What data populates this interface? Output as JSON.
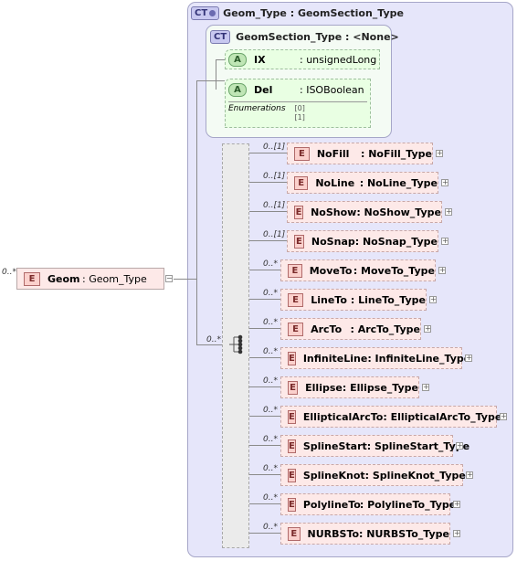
{
  "root_element": {
    "occurs": "0..*",
    "name": "Geom",
    "type": ": Geom_Type"
  },
  "complex_type": {
    "badge": "CT",
    "title": "Geom_Type : GeomSection_Type"
  },
  "base_type": {
    "badge": "CT",
    "title": "GeomSection_Type : <None>",
    "attributes": [
      {
        "badge": "A",
        "name": "IX",
        "type": ": unsignedLong"
      },
      {
        "badge": "A",
        "name": "Del",
        "type": ": ISOBoolean",
        "enum_label": "Enumerations",
        "enum_values": [
          "[0]",
          "[1]"
        ]
      }
    ]
  },
  "sequence": {
    "occurs": "0..*"
  },
  "children": [
    {
      "occurs": "0..[1]",
      "name": "NoFill",
      "type": ": NoFill_Type"
    },
    {
      "occurs": "0..[1]",
      "name": "NoLine",
      "type": ": NoLine_Type"
    },
    {
      "occurs": "0..[1]",
      "name": "NoShow",
      "type": ": NoShow_Type"
    },
    {
      "occurs": "0..[1]",
      "name": "NoSnap",
      "type": ": NoSnap_Type"
    },
    {
      "occurs": "0..*",
      "name": "MoveTo",
      "type": ": MoveTo_Type"
    },
    {
      "occurs": "0..*",
      "name": "LineTo",
      "type": ": LineTo_Type"
    },
    {
      "occurs": "0..*",
      "name": "ArcTo",
      "type": ": ArcTo_Type"
    },
    {
      "occurs": "0..*",
      "name": "InfiniteLine",
      "type": ": InfiniteLine_Type"
    },
    {
      "occurs": "0..*",
      "name": "Ellipse",
      "type": ": Ellipse_Type"
    },
    {
      "occurs": "0..*",
      "name": "EllipticalArcTo",
      "type": ": EllipticalArcTo_Type"
    },
    {
      "occurs": "0..*",
      "name": "SplineStart",
      "type": ": SplineStart_Type"
    },
    {
      "occurs": "0..*",
      "name": "SplineKnot",
      "type": ": SplineKnot_Type"
    },
    {
      "occurs": "0..*",
      "name": "PolylineTo",
      "type": ": PolylineTo_Type"
    },
    {
      "occurs": "0..*",
      "name": "NURBSTo",
      "type": ": NURBSTo_Type"
    }
  ],
  "plus_glyph": "+",
  "minus_glyph": "−",
  "element_badge": "E"
}
